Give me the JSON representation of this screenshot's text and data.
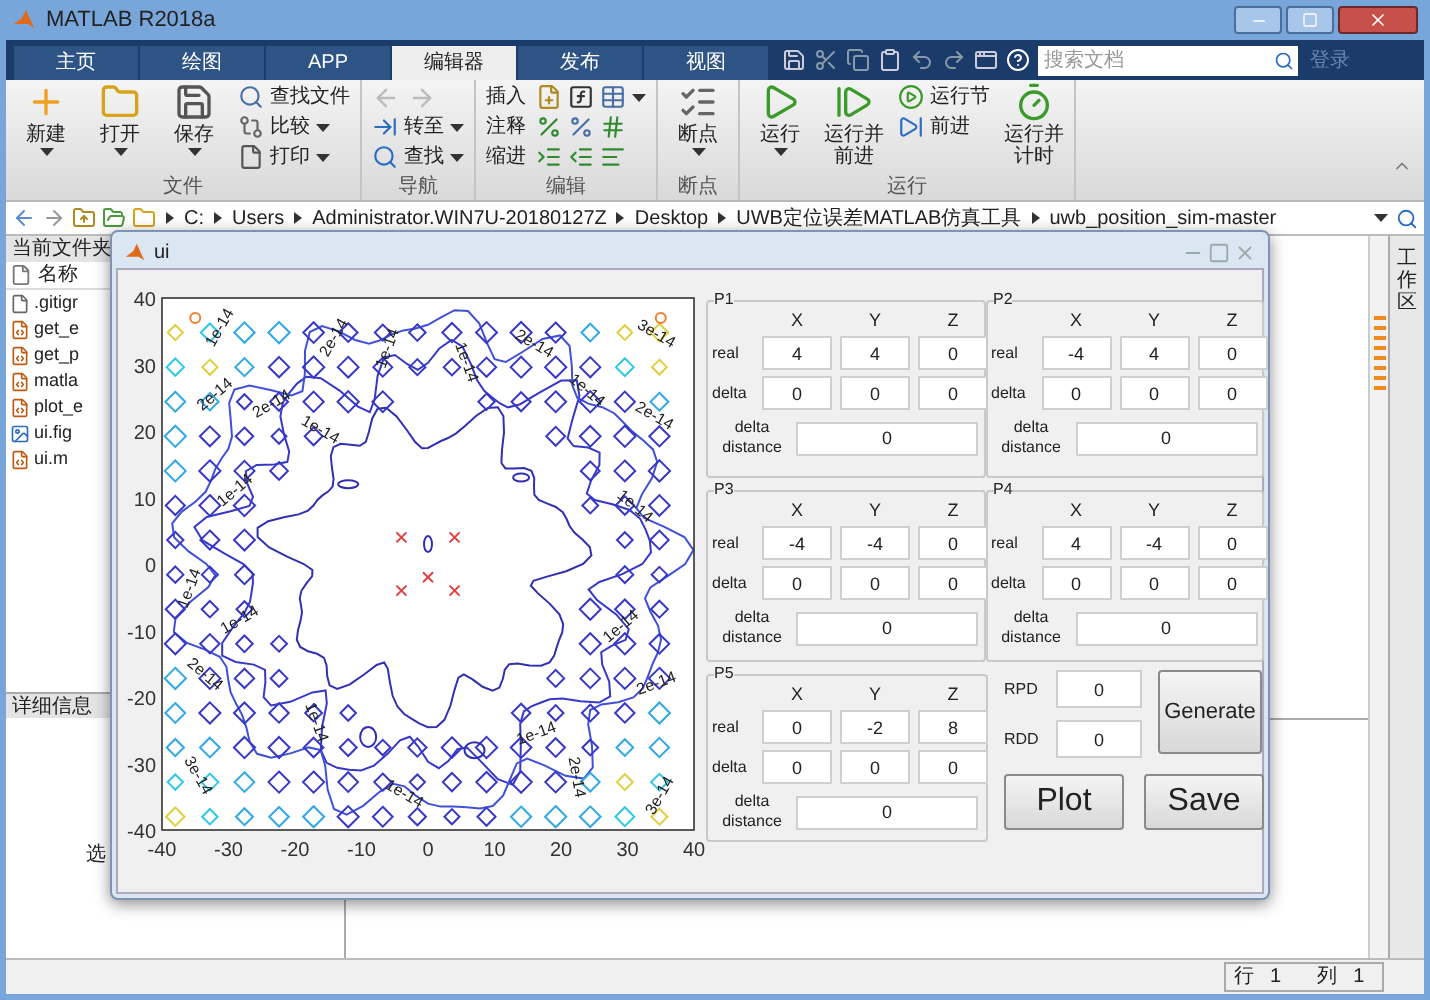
{
  "window": {
    "title": "MATLAB R2018a"
  },
  "tabs": [
    {
      "label": "主页",
      "selected": false
    },
    {
      "label": "绘图",
      "selected": false
    },
    {
      "label": "APP",
      "selected": false
    },
    {
      "label": "编辑器",
      "selected": true
    },
    {
      "label": "发布",
      "selected": false
    },
    {
      "label": "视图",
      "selected": false
    }
  ],
  "search": {
    "placeholder": "搜索文档"
  },
  "login": "登录",
  "ribbon": [
    {
      "label": "文件",
      "items": [
        {
          "kind": "large",
          "label": "新建",
          "dropdown": true
        },
        {
          "kind": "large",
          "label": "打开",
          "dropdown": true
        },
        {
          "kind": "large",
          "label": "保存",
          "dropdown": true
        },
        {
          "kind": "stack",
          "items": [
            {
              "kind": "button",
              "label": "查找文件",
              "dropdown": false
            },
            {
              "kind": "button",
              "label": "比较",
              "dropdown": true
            },
            {
              "kind": "button",
              "label": "打印",
              "dropdown": true
            }
          ]
        }
      ]
    },
    {
      "label": "导航",
      "items": [
        {
          "kind": "stack",
          "items": [
            {
              "kind": "arrows",
              "disabled": true
            },
            {
              "kind": "button",
              "label": "转至",
              "dropdown": true
            },
            {
              "kind": "button",
              "label": "查找",
              "dropdown": true
            }
          ]
        }
      ]
    },
    {
      "label": "编辑",
      "items": [
        {
          "kind": "stack",
          "items": [
            {
              "kind": "row",
              "label": "插入",
              "dropdown": true
            },
            {
              "kind": "row",
              "label": "注释",
              "dropdown": false
            },
            {
              "kind": "row",
              "label": "缩进",
              "dropdown": false
            }
          ]
        }
      ]
    },
    {
      "label": "断点",
      "items": [
        {
          "kind": "large",
          "label": "断点",
          "dropdown": true
        }
      ]
    },
    {
      "label": "运行",
      "items": [
        {
          "kind": "large",
          "label": "运行",
          "dropdown": true
        },
        {
          "kind": "large",
          "label": "运行并前进",
          "dropdown": false
        },
        {
          "kind": "stack",
          "items": [
            {
              "kind": "button",
              "label": "运行节",
              "dropdown": false
            },
            {
              "kind": "button",
              "label": "前进",
              "dropdown": false
            }
          ]
        },
        {
          "kind": "large",
          "label": "运行并计时",
          "dropdown": false
        }
      ]
    }
  ],
  "path": [
    "C:",
    "Users",
    "Administrator.WIN7U-20180127Z",
    "Desktop",
    "UWB定位误差MATLAB仿真工具",
    "uwb_position_sim-master"
  ],
  "current_folder": {
    "title": "当前文件夹",
    "column": "名称",
    "files": [
      {
        "name": ".gitigr",
        "kind": "file"
      },
      {
        "name": "get_e",
        "kind": "script"
      },
      {
        "name": "get_p",
        "kind": "script"
      },
      {
        "name": "matla",
        "kind": "script"
      },
      {
        "name": "plot_e",
        "kind": "script"
      },
      {
        "name": "ui.fig",
        "kind": "figure"
      },
      {
        "name": "ui.m",
        "kind": "script"
      }
    ]
  },
  "details": {
    "title": "详细信息",
    "text": "选"
  },
  "workspace": {
    "title": "工作区"
  },
  "status_bar": {
    "row_label": "行",
    "row": "1",
    "col_label": "列",
    "col": "1"
  },
  "figure": {
    "title": "ui",
    "axes": {
      "xticks": [
        "-40",
        "-30",
        "-20",
        "-10",
        "0",
        "10",
        "20",
        "30",
        "40"
      ],
      "yticks": [
        "40",
        "30",
        "20",
        "10",
        "0",
        "-10",
        "-20",
        "-30",
        "-40"
      ],
      "contour_labels": [
        "1e-14",
        "2e-14",
        "1e-14",
        "1e-14",
        "2e-14",
        "3e-14",
        "2e-14",
        "2e-14",
        "1e-14",
        "2e-14",
        "1e-14",
        "1e-14",
        "1e-14",
        "1e-14",
        "1e-14",
        "1e-14",
        "2e-14",
        "2e-14",
        "1e-14",
        "1e-14",
        "3e-14",
        "2e-14",
        "1e-14",
        "3e-14"
      ]
    },
    "points": [
      {
        "title": "P1",
        "columns": [
          "X",
          "Y",
          "Z"
        ],
        "real_label": "real",
        "real": [
          "4",
          "4",
          "0"
        ],
        "delta_label": "delta",
        "delta": [
          "0",
          "0",
          "0"
        ],
        "distance_label": "delta distance",
        "distance": "0"
      },
      {
        "title": "P2",
        "columns": [
          "X",
          "Y",
          "Z"
        ],
        "real_label": "real",
        "real": [
          "-4",
          "4",
          "0"
        ],
        "delta_label": "delta",
        "delta": [
          "0",
          "0",
          "0"
        ],
        "distance_label": "delta distance",
        "distance": "0"
      },
      {
        "title": "P3",
        "columns": [
          "X",
          "Y",
          "Z"
        ],
        "real_label": "real",
        "real": [
          "-4",
          "-4",
          "0"
        ],
        "delta_label": "delta",
        "delta": [
          "0",
          "0",
          "0"
        ],
        "distance_label": "delta distance",
        "distance": "0"
      },
      {
        "title": "P4",
        "columns": [
          "X",
          "Y",
          "Z"
        ],
        "real_label": "real",
        "real": [
          "4",
          "-4",
          "0"
        ],
        "delta_label": "delta",
        "delta": [
          "0",
          "0",
          "0"
        ],
        "distance_label": "delta distance",
        "distance": "0"
      },
      {
        "title": "P5",
        "columns": [
          "X",
          "Y",
          "Z"
        ],
        "real_label": "real",
        "real": [
          "0",
          "-2",
          "8"
        ],
        "delta_label": "delta",
        "delta": [
          "0",
          "0",
          "0"
        ],
        "distance_label": "delta distance",
        "distance": "0"
      }
    ],
    "rpd": {
      "label": "RPD",
      "value": "0"
    },
    "rdd": {
      "label": "RDD",
      "value": "0"
    },
    "buttons": [
      "Generate",
      "Plot",
      "Save"
    ]
  }
}
